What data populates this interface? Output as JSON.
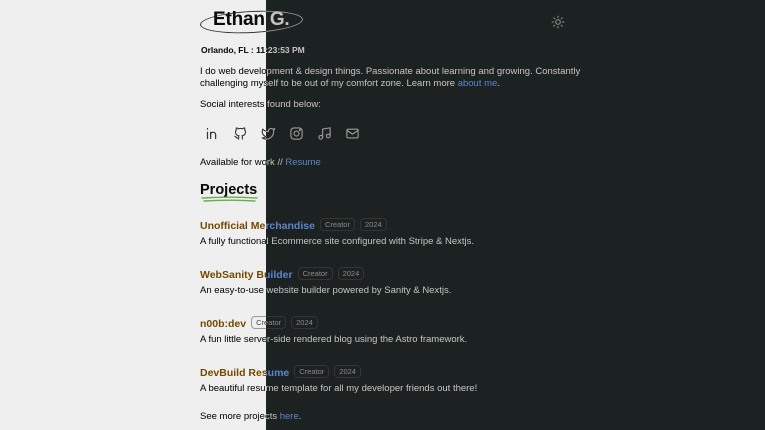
{
  "header": {
    "name": "Ethan G.",
    "theme_toggle_icon": "sun-icon"
  },
  "location": "Orlando, FL : 11:23:53 PM",
  "bio": {
    "text": "I do web development & design things. Passionate about learning and growing. Constantly challenging myself to be out of my comfort zone. Learn more ",
    "link_label": "about me",
    "suffix": "."
  },
  "social": {
    "label": "Social interests found below:",
    "icons": [
      "linkedin-icon",
      "github-icon",
      "twitter-icon",
      "instagram-icon",
      "music-icon",
      "mail-icon"
    ]
  },
  "availability": {
    "text": "Available for work // ",
    "link_label": "Resume"
  },
  "projects": {
    "heading": "Projects",
    "items": [
      {
        "title": "Unofficial Merchandise",
        "role": "Creator",
        "year": "2024",
        "description": "A fully functional Ecommerce site configured with Stripe & Nextjs."
      },
      {
        "title": "WebSanity Builder",
        "role": "Creator",
        "year": "2024",
        "description": "An easy-to-use website builder powered by Sanity & Nextjs."
      },
      {
        "title": "n00b:dev",
        "role": "Creator",
        "year": "2024",
        "description": "A fun little server-side rendered blog using the Astro framework."
      },
      {
        "title": "DevBuild Resume",
        "role": "Creator",
        "year": "2024",
        "description": "A beautiful resume template for all my developer friends out there!"
      }
    ],
    "see_more_text": "See more projects ",
    "see_more_link": "here",
    "see_more_suffix": "."
  },
  "colors": {
    "light_bg": "#efefef",
    "dark_bg": "#1c2122",
    "link": "#7aa6ee",
    "underline_accent": "#8a3fa0"
  }
}
